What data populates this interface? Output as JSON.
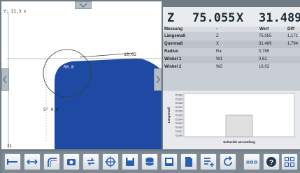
{
  "viewport": {
    "corner_label": "Y: 21,3 x",
    "radius_label": "R0.8",
    "angle_label": "16,02",
    "dimension_label": "5° 0,6",
    "bottom_label": "21"
  },
  "readout": [
    {
      "axis": "Z",
      "value": "75.055"
    },
    {
      "axis": "X",
      "value": "31.489"
    }
  ],
  "table": {
    "headers": [
      "Messung",
      "-",
      "Wert",
      "Diff"
    ],
    "rows": [
      {
        "name": "Längemaß",
        "symbol": "Z",
        "value": "75,055",
        "diff": "1,171"
      },
      {
        "name": "Quermaß",
        "symbol": "X",
        "value": "31,489",
        "diff": "1,794"
      },
      {
        "name": "Radius",
        "symbol": "Ra",
        "value": "0,785",
        "diff": ""
      },
      {
        "name": "Winkel 1",
        "symbol": "W1",
        "value": "0,61",
        "diff": ""
      },
      {
        "name": "Winkel 2",
        "symbol": "W2",
        "value": "16,02",
        "diff": ""
      }
    ]
  },
  "chart_data": {
    "type": "bar",
    "title": "",
    "ylabel": "Längemaß",
    "xlabel": "Schneide am Umfang",
    "y_ticks": [
      "75.060",
      "75.059",
      "75.058",
      "75.057",
      "75.056",
      "75.055",
      "75.054",
      "75.053",
      "75.052",
      "75.051",
      "75.050"
    ],
    "ylim": [
      75.05,
      75.06
    ],
    "categories": [
      ""
    ],
    "values": [
      75.055
    ]
  },
  "toolbar": {
    "buttons": [
      {
        "name": "measure-horizontal-icon"
      },
      {
        "name": "measure-arrows-icon"
      },
      {
        "name": "radius-tool-icon"
      },
      {
        "name": "camera-icon"
      },
      {
        "name": "refresh-icon"
      },
      {
        "name": "crosshair-icon"
      },
      {
        "name": "save-icon"
      },
      {
        "name": "database-icon"
      },
      {
        "name": "screen-icon"
      },
      {
        "name": "document-icon"
      },
      {
        "name": "list-add-icon"
      },
      {
        "name": "rotate-icon"
      },
      {
        "name": "more-icon"
      },
      {
        "name": "help-icon"
      },
      {
        "name": "grid-icon"
      }
    ]
  }
}
